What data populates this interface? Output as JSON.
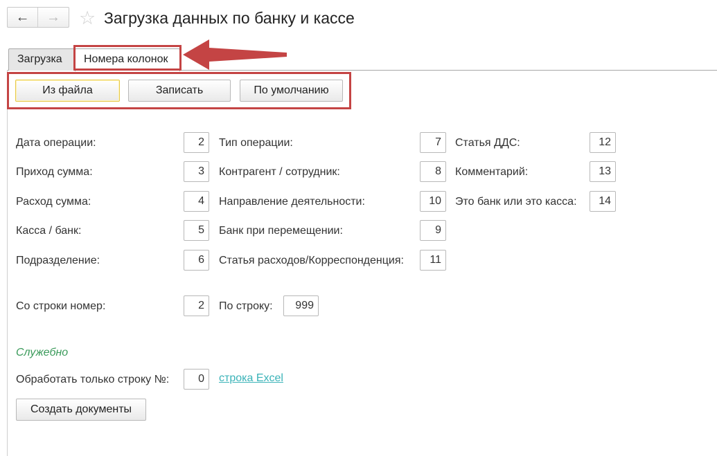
{
  "header": {
    "title": "Загрузка данных по банку и кассе",
    "back_icon": "arrow-left-icon",
    "forward_icon": "arrow-right-icon",
    "favorite_icon": "star-icon"
  },
  "tabs": [
    {
      "label": "Загрузка",
      "active": false
    },
    {
      "label": "Номера колонок",
      "active": true
    }
  ],
  "toolbar": {
    "from_file": "Из файла",
    "save": "Записать",
    "default": "По умолчанию"
  },
  "columns": {
    "date": {
      "label": "Дата операции:",
      "value": "2"
    },
    "income": {
      "label": "Приход сумма:",
      "value": "3"
    },
    "expense": {
      "label": "Расход сумма:",
      "value": "4"
    },
    "cash_bank": {
      "label": "Касса / банк:",
      "value": "5"
    },
    "department": {
      "label": "Подразделение:",
      "value": "6"
    },
    "op_type": {
      "label": "Тип операции:",
      "value": "7"
    },
    "counterparty": {
      "label": "Контрагент / сотрудник:",
      "value": "8"
    },
    "activity": {
      "label": "Направление деятельности:",
      "value": "10"
    },
    "transfer_bank": {
      "label": "Банк при перемещении:",
      "value": "9"
    },
    "expense_item": {
      "label": "Статья расходов/Корреспонденция:",
      "value": "11"
    },
    "cashflow_item": {
      "label": "Статья ДДС:",
      "value": "12"
    },
    "comment": {
      "label": "Комментарий:",
      "value": "13"
    },
    "bank_or_cash": {
      "label": "Это банк или это касса:",
      "value": "14"
    }
  },
  "rows": {
    "from_label": "Со строки номер:",
    "from_value": "2",
    "to_label": "По строку:",
    "to_value": "999"
  },
  "service": {
    "title": "Служебно",
    "only_row_label": "Обработать только строку №:",
    "only_row_value": "0",
    "excel_link": "строка Excel",
    "create_button": "Создать документы"
  },
  "colors": {
    "highlight": "#c44444",
    "section_title": "#3a9a5a",
    "link": "#3ab3b8"
  }
}
